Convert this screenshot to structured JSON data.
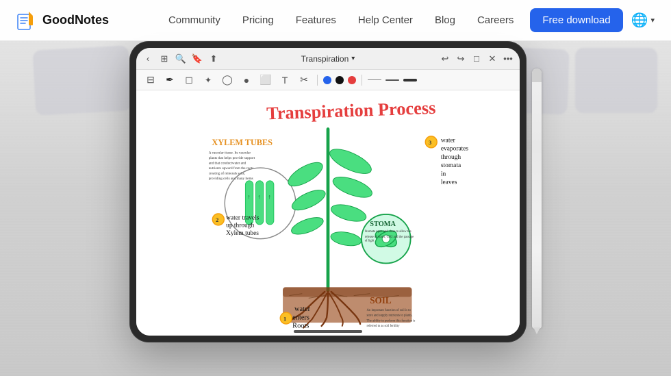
{
  "header": {
    "logo_text": "GoodNotes",
    "nav_items": [
      {
        "label": "Community",
        "id": "community"
      },
      {
        "label": "Pricing",
        "id": "pricing"
      },
      {
        "label": "Features",
        "id": "features"
      },
      {
        "label": "Help Center",
        "id": "help-center"
      },
      {
        "label": "Blog",
        "id": "blog"
      },
      {
        "label": "Careers",
        "id": "careers"
      }
    ],
    "cta_button": "Free download",
    "globe_label": "🌐"
  },
  "app": {
    "title": "Transpiration",
    "document_title": "Transpiration Process",
    "toolbar": {
      "tools": [
        "sidebar",
        "pen",
        "eraser",
        "lasso",
        "shape",
        "record",
        "image",
        "text",
        "scissors"
      ],
      "colors": [
        "blue",
        "black",
        "red"
      ],
      "lines": [
        "thin",
        "medium",
        "thick"
      ]
    }
  },
  "colors": {
    "brand_blue": "#2563eb",
    "nav_text": "#444444",
    "header_bg": "rgba(255,255,255,0.95)"
  }
}
